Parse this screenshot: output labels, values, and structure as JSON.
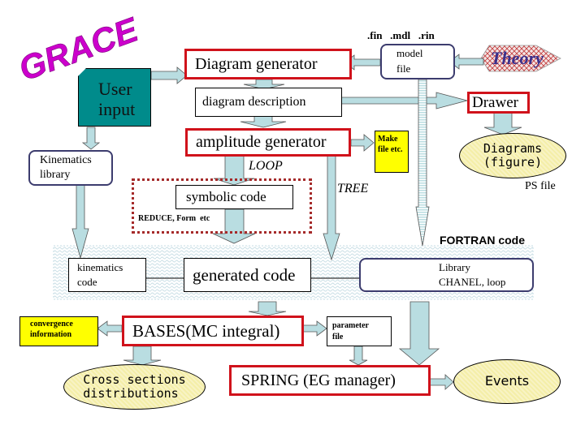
{
  "title": "GRACE",
  "colors": {
    "accent_red": "#d0121b",
    "title_magenta": "#cc00cc",
    "teal": "#008b8b",
    "arrow_fill": "#b9dde1",
    "yellow": "#ffff00",
    "ellipse_fill": "#f6f0b4",
    "theory_text": "#3a2f8c"
  },
  "nodes": {
    "user_input": "User\ninput",
    "diagram_generator": "Diagram generator",
    "model_file": "model\nfile",
    "file_extensions": ".fin   .mdl   .rin",
    "theory": "Theory",
    "diagram_description": "diagram description",
    "drawer": "Drawer",
    "amplitude_generator": "amplitude generator",
    "makefile": "Make\nfile etc.",
    "diagrams_figure": "Diagrams\n(figure)",
    "ps_file": "PS file",
    "kinematics_library": "Kinematics\nlibrary",
    "loop_label": "LOOP",
    "tree_label": "TREE",
    "symbolic_code": "symbolic code",
    "reduce_form": "REDUCE, Form  etc",
    "fortran_code": "FORTRAN code",
    "kinematics_code": "kinematics\ncode",
    "generated_code": "generated code",
    "library_chanel": "Library\nCHANEL, loop",
    "convergence_info": "convergence\ninformation",
    "bases": "BASES(MC integral)",
    "parameter_file": "parameter\nfile",
    "cross_sections": "Cross sections\ndistributions",
    "spring": "SPRING (EG manager)",
    "events": "Events"
  }
}
